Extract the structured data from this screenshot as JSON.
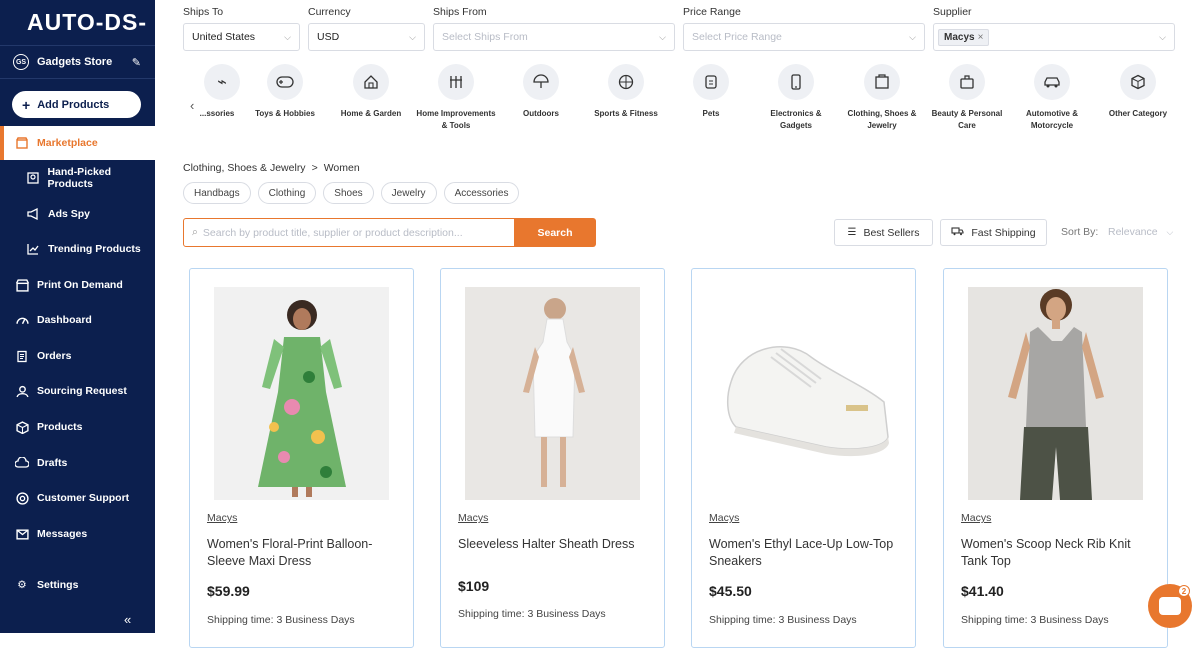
{
  "sidebar": {
    "logo": "AUTO-DS-",
    "store_badge": "GS",
    "store_name": "Gadgets Store",
    "add_products": "Add Products",
    "items": [
      {
        "label": "Marketplace",
        "icon": "store-icon"
      },
      {
        "label": "Hand-Picked Products",
        "icon": "hand-picked-icon"
      },
      {
        "label": "Ads Spy",
        "icon": "megaphone-icon"
      },
      {
        "label": "Trending Products",
        "icon": "trend-chart-icon"
      },
      {
        "label": "Print On Demand",
        "icon": "print-store-icon"
      },
      {
        "label": "Dashboard",
        "icon": "gauge-icon"
      },
      {
        "label": "Orders",
        "icon": "document-icon"
      },
      {
        "label": "Sourcing Request",
        "icon": "sourcing-icon"
      },
      {
        "label": "Products",
        "icon": "box-icon"
      },
      {
        "label": "Drafts",
        "icon": "cloud-icon"
      },
      {
        "label": "Customer Support",
        "icon": "support-icon"
      },
      {
        "label": "Messages",
        "icon": "mail-icon"
      },
      {
        "label": "Settings",
        "icon": "gear-icon"
      }
    ]
  },
  "filters": {
    "ships_to": {
      "label": "Ships To",
      "value": "United States"
    },
    "currency": {
      "label": "Currency",
      "value": "USD"
    },
    "ships_from": {
      "label": "Ships From",
      "placeholder": "Select Ships From"
    },
    "price_range": {
      "label": "Price Range",
      "placeholder": "Select Price Range"
    },
    "supplier": {
      "label": "Supplier",
      "tag": "Macys"
    }
  },
  "categories": [
    {
      "label": "...ssories",
      "icon": "accessories-icon"
    },
    {
      "label": "Toys & Hobbies",
      "icon": "gamepad-icon"
    },
    {
      "label": "Home & Garden",
      "icon": "house-icon"
    },
    {
      "label": "Home Improvements & Tools",
      "icon": "tools-icon"
    },
    {
      "label": "Outdoors",
      "icon": "umbrella-icon"
    },
    {
      "label": "Sports & Fitness",
      "icon": "basketball-icon"
    },
    {
      "label": "Pets",
      "icon": "pet-icon"
    },
    {
      "label": "Electronics & Gadgets",
      "icon": "phone-icon"
    },
    {
      "label": "Clothing, Shoes & Jewelry",
      "icon": "apparel-icon"
    },
    {
      "label": "Beauty & Personal Care",
      "icon": "beauty-icon"
    },
    {
      "label": "Automotive & Motorcycle",
      "icon": "car-icon"
    },
    {
      "label": "Other Category",
      "icon": "cube-icon"
    }
  ],
  "breadcrumb": {
    "parent": "Clothing, Shoes & Jewelry",
    "separator": ">",
    "current": "Women"
  },
  "subcategories": [
    "Handbags",
    "Clothing",
    "Shoes",
    "Jewelry",
    "Accessories"
  ],
  "search": {
    "placeholder": "Search by product title, supplier or product description...",
    "button": "Search"
  },
  "toolbar": {
    "best_sellers": "Best Sellers",
    "fast_shipping": "Fast Shipping",
    "sort_by": "Sort By:",
    "sort_value": "Relevance"
  },
  "products": [
    {
      "supplier": "Macys",
      "title": "Women's Floral-Print Balloon-Sleeve Maxi Dress",
      "price": "$59.99",
      "shipping": "Shipping time: 3 Business Days"
    },
    {
      "supplier": "Macys",
      "title": "Sleeveless Halter Sheath Dress",
      "price": "$109",
      "shipping": "Shipping time: 3 Business Days"
    },
    {
      "supplier": "Macys",
      "title": "Women's Ethyl Lace-Up Low-Top Sneakers",
      "price": "$45.50",
      "shipping": "Shipping time: 3 Business Days"
    },
    {
      "supplier": "Macys",
      "title": "Women's Scoop Neck Rib Knit Tank Top",
      "price": "$41.40",
      "shipping": "Shipping time: 3 Business Days"
    }
  ],
  "chat": {
    "count": "2"
  },
  "colors": {
    "sidebar": "#0c1f4e",
    "accent": "#e8772e",
    "card_border": "#b9d6f2"
  }
}
